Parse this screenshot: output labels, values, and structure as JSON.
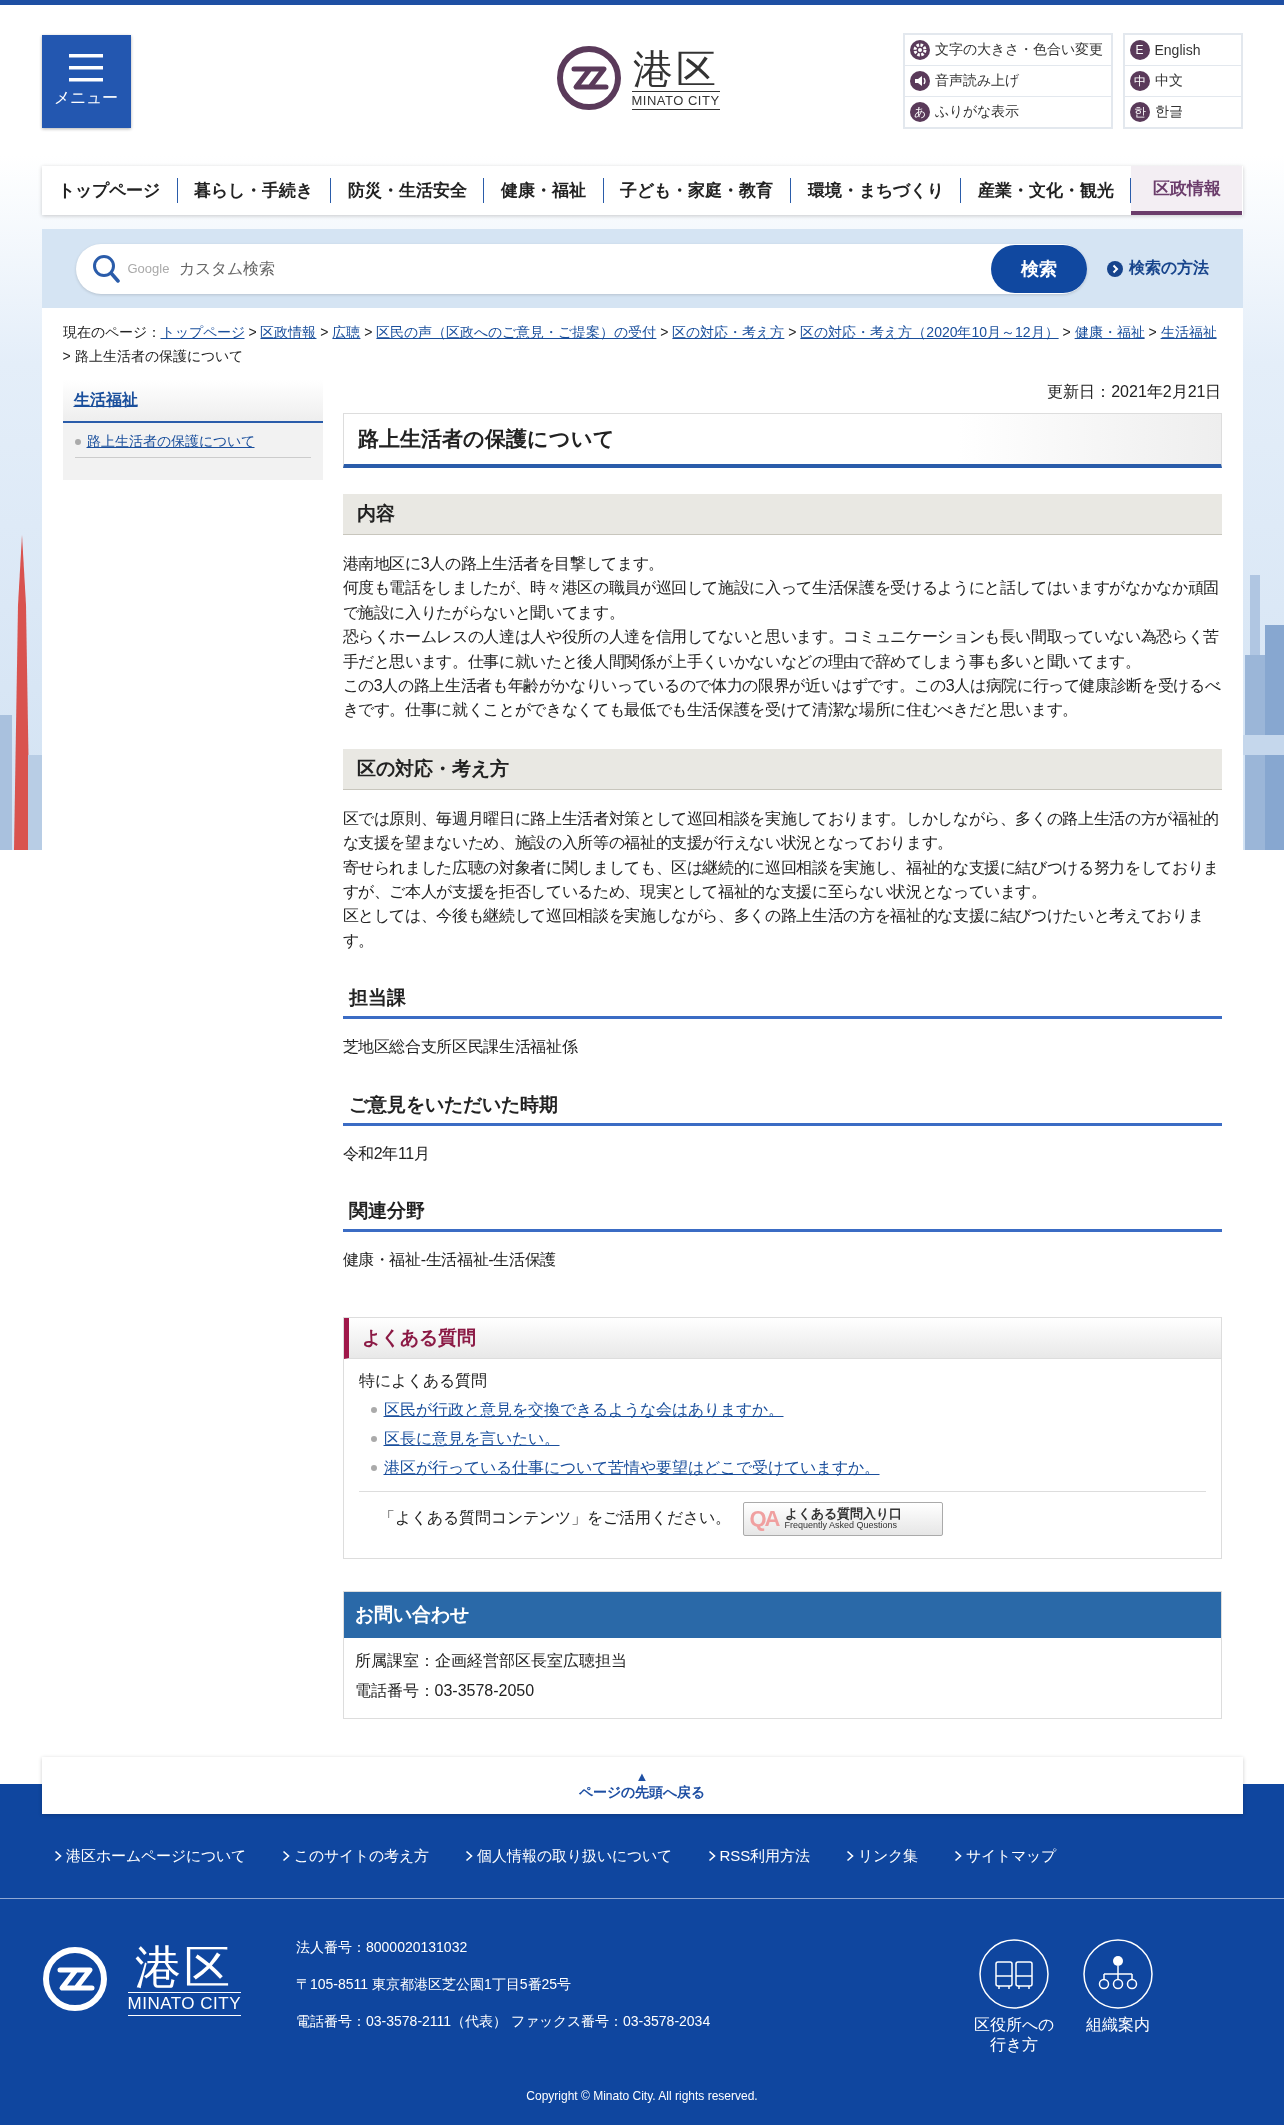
{
  "header": {
    "menu_button": {
      "label": "メニュー"
    },
    "logo": {
      "name": "港区",
      "sub": "MINATO CITY"
    },
    "tools": [
      {
        "kind": "gear",
        "label": "文字の大きさ・色合い変更"
      },
      {
        "kind": "speaker",
        "label": "音声読み上げ"
      },
      {
        "kind": "char",
        "badge": "あ",
        "label": "ふりがな表示"
      }
    ],
    "languages": [
      {
        "badge": "E",
        "label": "English"
      },
      {
        "badge": "中",
        "label": "中文"
      },
      {
        "badge": "한",
        "label": "한글"
      }
    ]
  },
  "nav": {
    "items": [
      {
        "label": "トップページ",
        "selected": false
      },
      {
        "label": "暮らし・手続き",
        "selected": false
      },
      {
        "label": "防災・生活安全",
        "selected": false
      },
      {
        "label": "健康・福祉",
        "selected": false
      },
      {
        "label": "子ども・家庭・教育",
        "selected": false
      },
      {
        "label": "環境・まちづくり",
        "selected": false
      },
      {
        "label": "産業・文化・観光",
        "selected": false
      },
      {
        "label": "区政情報",
        "selected": true
      }
    ]
  },
  "search": {
    "brand": "Google",
    "placeholder": "カスタム検索",
    "button": "検索",
    "help_link": "検索の方法"
  },
  "breadcrumb": {
    "prefix": "現在のページ：",
    "separator": ">",
    "links": [
      "トップページ",
      "区政情報",
      "広聴",
      "区民の声（区政へのご意見・ご提案）の受付",
      "区の対応・考え方",
      "区の対応・考え方（2020年10月～12月）",
      "健康・福祉",
      "生活福祉"
    ],
    "current": "路上生活者の保護について"
  },
  "sidebar": {
    "heading": "生活福祉",
    "items": [
      "路上生活者の保護について"
    ]
  },
  "updated": "更新日：2021年2月21日",
  "title": "路上生活者の保護について",
  "sections": [
    {
      "kind": "band",
      "heading": "内容",
      "paragraphs": [
        "港南地区に3人の路上生活者を目撃してます。",
        "何度も電話をしましたが、時々港区の職員が巡回して施設に入って生活保護を受けるようにと話してはいますがなかなか頑固で施設に入りたがらないと聞いてます。",
        "恐らくホームレスの人達は人や役所の人達を信用してないと思います。コミュニケーションも長い間取っていない為恐らく苦手だと思います。仕事に就いたと後人間関係が上手くいかないなどの理由で辞めてしまう事も多いと聞いてます。",
        "この3人の路上生活者も年齢がかなりいっているので体力の限界が近いはずです。この3人は病院に行って健康診断を受けるべきです。仕事に就くことができなくても最低でも生活保護を受けて清潔な場所に住むべきだと思います。"
      ]
    },
    {
      "kind": "band",
      "heading": "区の対応・考え方",
      "paragraphs": [
        "区では原則、毎週月曜日に路上生活者対策として巡回相談を実施しております。しかしながら、多くの路上生活の方が福祉的な支援を望まないため、施設の入所等の福祉的支援が行えない状況となっております。",
        "寄せられました広聴の対象者に関しましても、区は継続的に巡回相談を実施し、福祉的な支援に結びつける努力をしておりますが、ご本人が支援を拒否しているため、現実として福祉的な支援に至らない状況となっています。",
        "区としては、今後も継続して巡回相談を実施しながら、多くの路上生活の方を福祉的な支援に結びつけたいと考えております。"
      ]
    },
    {
      "kind": "underline",
      "heading": "担当課",
      "paragraphs": [
        "芝地区総合支所区民課生活福祉係"
      ]
    },
    {
      "kind": "underline",
      "heading": "ご意見をいただいた時期",
      "paragraphs": [
        "令和2年11月"
      ]
    },
    {
      "kind": "underline",
      "heading": "関連分野",
      "paragraphs": [
        "健康・福祉-生活福祉-生活保護"
      ]
    }
  ],
  "faq": {
    "heading": "よくある質問",
    "intro": "特によくある質問",
    "links": [
      "区民が行政と意見を交換できるような会はありますか。",
      "区長に意見を言いたい。",
      "港区が行っている仕事について苦情や要望はどこで受けていますか。"
    ],
    "note": "「よくある質問コンテンツ」をご活用ください。",
    "banner": {
      "mark": "QA",
      "title": "よくある質問入り口",
      "subtitle": "Frequently Asked Questions"
    }
  },
  "contact": {
    "heading": "お問い合わせ",
    "lines": [
      "所属課室：企画経営部区長室広聴担当",
      "電話番号：03-3578-2050"
    ]
  },
  "back_to_top": {
    "arrow": "▲",
    "label": "ページの先頭へ戻る"
  },
  "footer": {
    "links": [
      "港区ホームページについて",
      "このサイトの考え方",
      "個人情報の取り扱いについて",
      "RSS利用方法",
      "リンク集",
      "サイトマップ"
    ],
    "logo": {
      "name": "港区",
      "sub": "MINATO CITY"
    },
    "info": [
      "法人番号：8000020131032",
      "〒105-8511 東京都港区芝公園1丁目5番25号",
      "電話番号：03-3578-2111（代表） ファックス番号：03-3578-2034"
    ],
    "shortcuts": [
      {
        "kind": "bus",
        "label": "区役所への行き方"
      },
      {
        "kind": "org",
        "label": "組織案内"
      }
    ],
    "copyright": "Copyright © Minato City. All rights reserved."
  }
}
